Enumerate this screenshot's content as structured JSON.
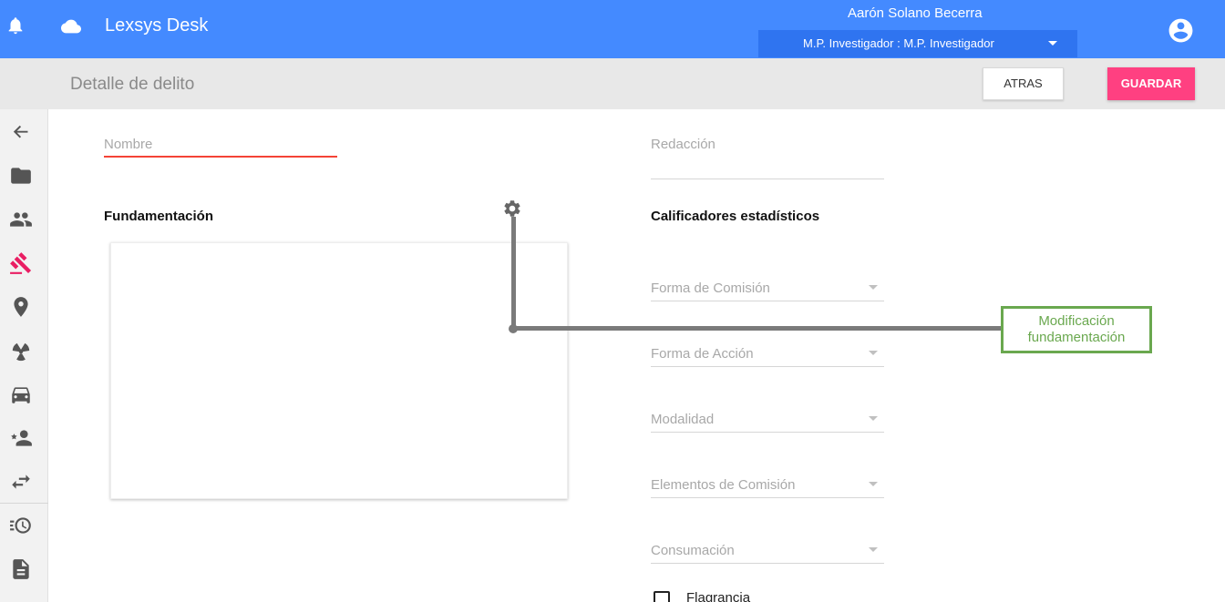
{
  "header": {
    "app_title": "Lexsys Desk",
    "user_name": "Aarón Solano Becerra",
    "role_selected": "M.P. Investigador : M.P. Investigador",
    "colors": {
      "bar": "#448aff",
      "select": "#2f74f0"
    }
  },
  "subheader": {
    "page_title": "Detalle de delito",
    "back_label": "ATRAS",
    "save_label": "GUARDAR",
    "save_color": "#ff4081"
  },
  "sidebar": {
    "items": [
      {
        "icon": "back-arrow-icon"
      },
      {
        "icon": "folder-icon"
      },
      {
        "icon": "people-icon"
      },
      {
        "icon": "gavel-icon",
        "active": true
      },
      {
        "icon": "location-pin-icon"
      },
      {
        "icon": "radiation-icon"
      },
      {
        "icon": "car-icon"
      },
      {
        "icon": "person-star-icon"
      },
      {
        "icon": "swap-icon"
      },
      {
        "icon": "history-icon"
      },
      {
        "icon": "document-icon"
      }
    ],
    "active_color": "#e91e63"
  },
  "form": {
    "nombre_placeholder": "Nombre",
    "redaccion_placeholder": "Redacción",
    "fundamentacion_title": "Fundamentación",
    "calificadores_title": "Calificadores estadísticos",
    "dropdowns": [
      {
        "label": "Forma de Comisión"
      },
      {
        "label": "Forma de Acción"
      },
      {
        "label": "Modalidad"
      },
      {
        "label": "Elementos de Comisión"
      },
      {
        "label": "Consumación"
      }
    ],
    "flagrancia_label": "Flagrancia",
    "error_color": "#f44336"
  },
  "annotation": {
    "text_line1": "Modificación",
    "text_line2": "fundamentación",
    "color": "#6aa84f"
  }
}
